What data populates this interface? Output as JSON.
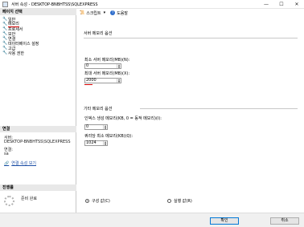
{
  "window": {
    "title": "서버 속성 - DESKTOP-BNBHTSS\\SQLEXPRESS",
    "min_glyph": "—",
    "max_glyph": "☐",
    "close_glyph": "✕"
  },
  "left_panel": {
    "pages_header": "페이지 선택",
    "pages": [
      {
        "label": "일반"
      },
      {
        "label": "메모리",
        "selected": true
      },
      {
        "label": "프로세서"
      },
      {
        "label": "보안"
      },
      {
        "label": "연결"
      },
      {
        "label": "데이터베이스 설정"
      },
      {
        "label": "고급"
      },
      {
        "label": "사용 권한"
      }
    ],
    "connection_header": "연결",
    "server_label": "서버:",
    "server_value": "DESKTOP-BNBHTSS\\SQLEXPRESS",
    "conn_label": "연결:",
    "conn_value": "sa",
    "view_conn_props": "연결 속성 보기",
    "progress_header": "진행률",
    "progress_status": "준비 완료"
  },
  "toolbar": {
    "script_label": "스크립트",
    "help_label": "도움말"
  },
  "main": {
    "server_memory_group": "서버 메모리 옵션",
    "min_mem_label": "최소 서버 메모리(MB)(N):",
    "min_mem_value": "0",
    "max_mem_label": "최대 서버 메모리(MB)(X):",
    "max_mem_value": "2000",
    "other_memory_group": "기타 메모리 옵션",
    "index_mem_label": "인덱스 생성 메모리(KB, 0 = 동적 메모리)(I):",
    "index_mem_value": "0",
    "min_query_mem_label": "쿼리당 최소 메모리(KB)(Q):",
    "min_query_mem_value": "1024",
    "configured_radio": "구성 값(C)",
    "running_radio": "실행 값(R)",
    "configured_selected": true
  },
  "footer": {
    "ok_label": "확인",
    "cancel_label": "취소"
  },
  "colors": {
    "accent_red": "#d60000",
    "link_blue": "#1d4fa6",
    "header_gray": "#e8e8e8"
  },
  "icons": [
    "app-icon",
    "wrench-icon",
    "script-icon",
    "help-icon",
    "connection-icon",
    "progress-icon"
  ]
}
